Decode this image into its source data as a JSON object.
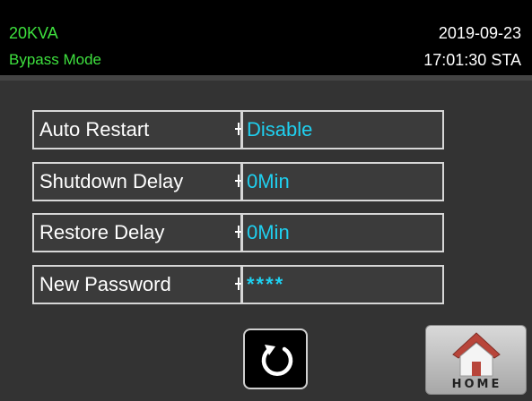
{
  "header": {
    "model": "20KVA",
    "mode": "Bypass Mode",
    "date": "2019-09-23",
    "time": "17:01:30 STA"
  },
  "settings": [
    {
      "label": "Auto Restart",
      "value": "Disable"
    },
    {
      "label": "Shutdown Delay",
      "value": "0Min"
    },
    {
      "label": "Restore Delay",
      "value": "0Min"
    },
    {
      "label": "New Password",
      "value": "****"
    }
  ],
  "buttons": {
    "back_icon": "refresh-icon",
    "home_label": "HOME"
  },
  "colors": {
    "header_text": "#3ee03e",
    "value_text": "#1fd0f0",
    "panel_bg": "#333333"
  }
}
